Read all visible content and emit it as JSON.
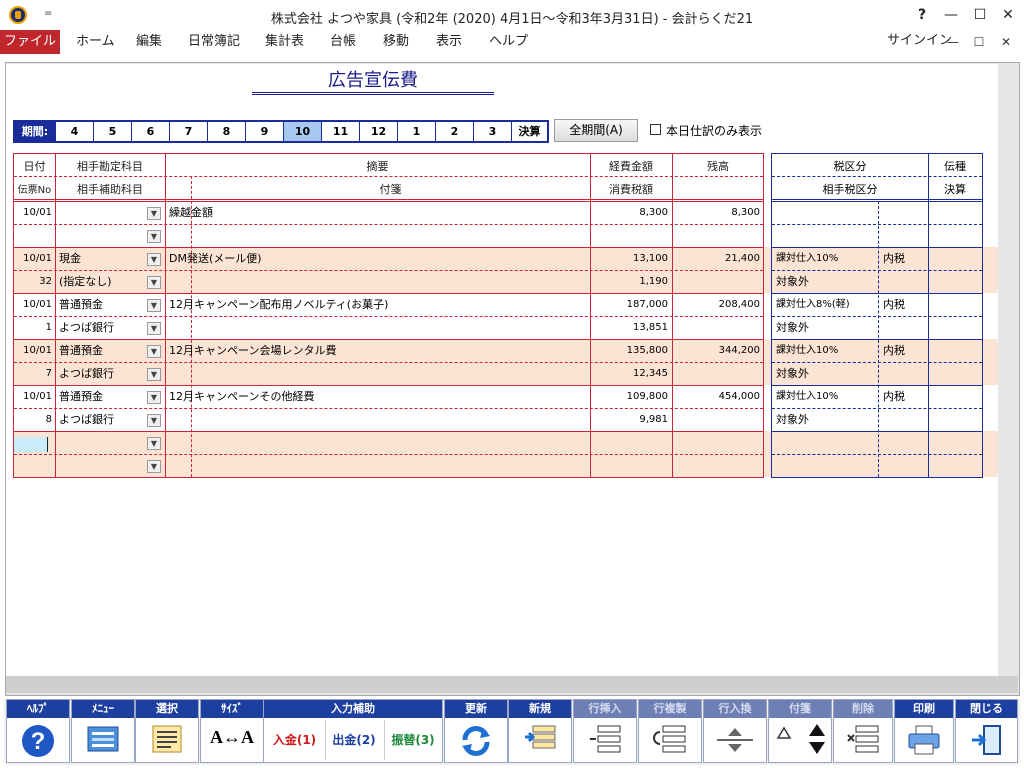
{
  "window": {
    "title": "株式会社 よつや家具 (令和2年 (2020) 4月1日～令和3年3月31日) - 会計らくだ21",
    "help_glyph": "?",
    "minimize_glyph": "—",
    "maximize_glyph": "☐",
    "close_glyph": "✕",
    "qa_glyph": "="
  },
  "menu": {
    "items": [
      "ファイル",
      "ホーム",
      "編集",
      "日常簿記",
      "集計表",
      "台帳",
      "移動",
      "表示",
      "ヘルプ"
    ],
    "signin": "サインイン"
  },
  "sheet": {
    "title": "広告宣伝費",
    "period_label": "期間:",
    "periods": [
      "4",
      "5",
      "6",
      "7",
      "8",
      "9",
      "10",
      "11",
      "12",
      "1",
      "2",
      "3",
      "決算"
    ],
    "active_period": "10",
    "all_period_button": "全期間(A)",
    "today_only_label": "本日仕訳のみ表示"
  },
  "headers": {
    "date": "日付",
    "voucher_no": "伝票No",
    "account": "相手勘定科目",
    "sub_account": "相手補助科目",
    "summary": "摘要",
    "note": "付箋",
    "expense_amount": "経費金額",
    "tax_amount": "消費税額",
    "balance": "残高",
    "tax_category": "税区分",
    "partner_tax": "相手税区分",
    "voucher_type": "伝種",
    "closing": "決算"
  },
  "rows": [
    {
      "date": "10/01",
      "no": "",
      "account": "",
      "sub": "",
      "summary": "繰越金額",
      "amount": "8,300",
      "tax": "",
      "balance": "8,300",
      "taxcat": "",
      "taxcat2": "",
      "inclusive": ""
    },
    {
      "date": "10/01",
      "no": "32",
      "account": "現金",
      "sub": "(指定なし)",
      "summary": "DM発送(メール便)",
      "amount": "13,100",
      "tax": "1,190",
      "balance": "21,400",
      "taxcat": "課対仕入10%",
      "taxcat2": "対象外",
      "inclusive": "内税"
    },
    {
      "date": "10/01",
      "no": "1",
      "account": "普通預金",
      "sub": "よつば銀行",
      "summary": "12月キャンペーン配布用ノベルティ(お菓子)",
      "amount": "187,000",
      "tax": "13,851",
      "balance": "208,400",
      "taxcat": "課対仕入8%(軽)",
      "taxcat2": "対象外",
      "inclusive": "内税"
    },
    {
      "date": "10/01",
      "no": "7",
      "account": "普通預金",
      "sub": "よつば銀行",
      "summary": "12月キャンペーン会場レンタル費",
      "amount": "135,800",
      "tax": "12,345",
      "balance": "344,200",
      "taxcat": "課対仕入10%",
      "taxcat2": "対象外",
      "inclusive": "内税"
    },
    {
      "date": "10/01",
      "no": "8",
      "account": "普通預金",
      "sub": "よつば銀行",
      "summary": "12月キャンペーンその他経費",
      "amount": "109,800",
      "tax": "9,981",
      "balance": "454,000",
      "taxcat": "課対仕入10%",
      "taxcat2": "対象外",
      "inclusive": "内税"
    }
  ],
  "toolbar": {
    "help": "ﾍﾙﾌﾟ",
    "menu": "ﾒﾆｭｰ",
    "select": "選択",
    "size": "ｻｲｽﾞ",
    "input_help": "入力補助",
    "deposit": "入金(1)",
    "withdraw": "出金(2)",
    "transfer": "振替(3)",
    "refresh": "更新",
    "new": "新規",
    "insert_row": "行挿入",
    "copy_row": "行複製",
    "swap_row": "行入換",
    "sticky": "付箋",
    "delete": "削除",
    "print": "印刷",
    "close": "閉じる",
    "size_glyph": "A↔A"
  },
  "colors": {
    "accent_red": "#c0272d",
    "grid_red": "#c8243a",
    "grid_blue": "#1a2c9a",
    "band": "#fbe4d4",
    "toolbar_blue": "#1c3fa0"
  }
}
